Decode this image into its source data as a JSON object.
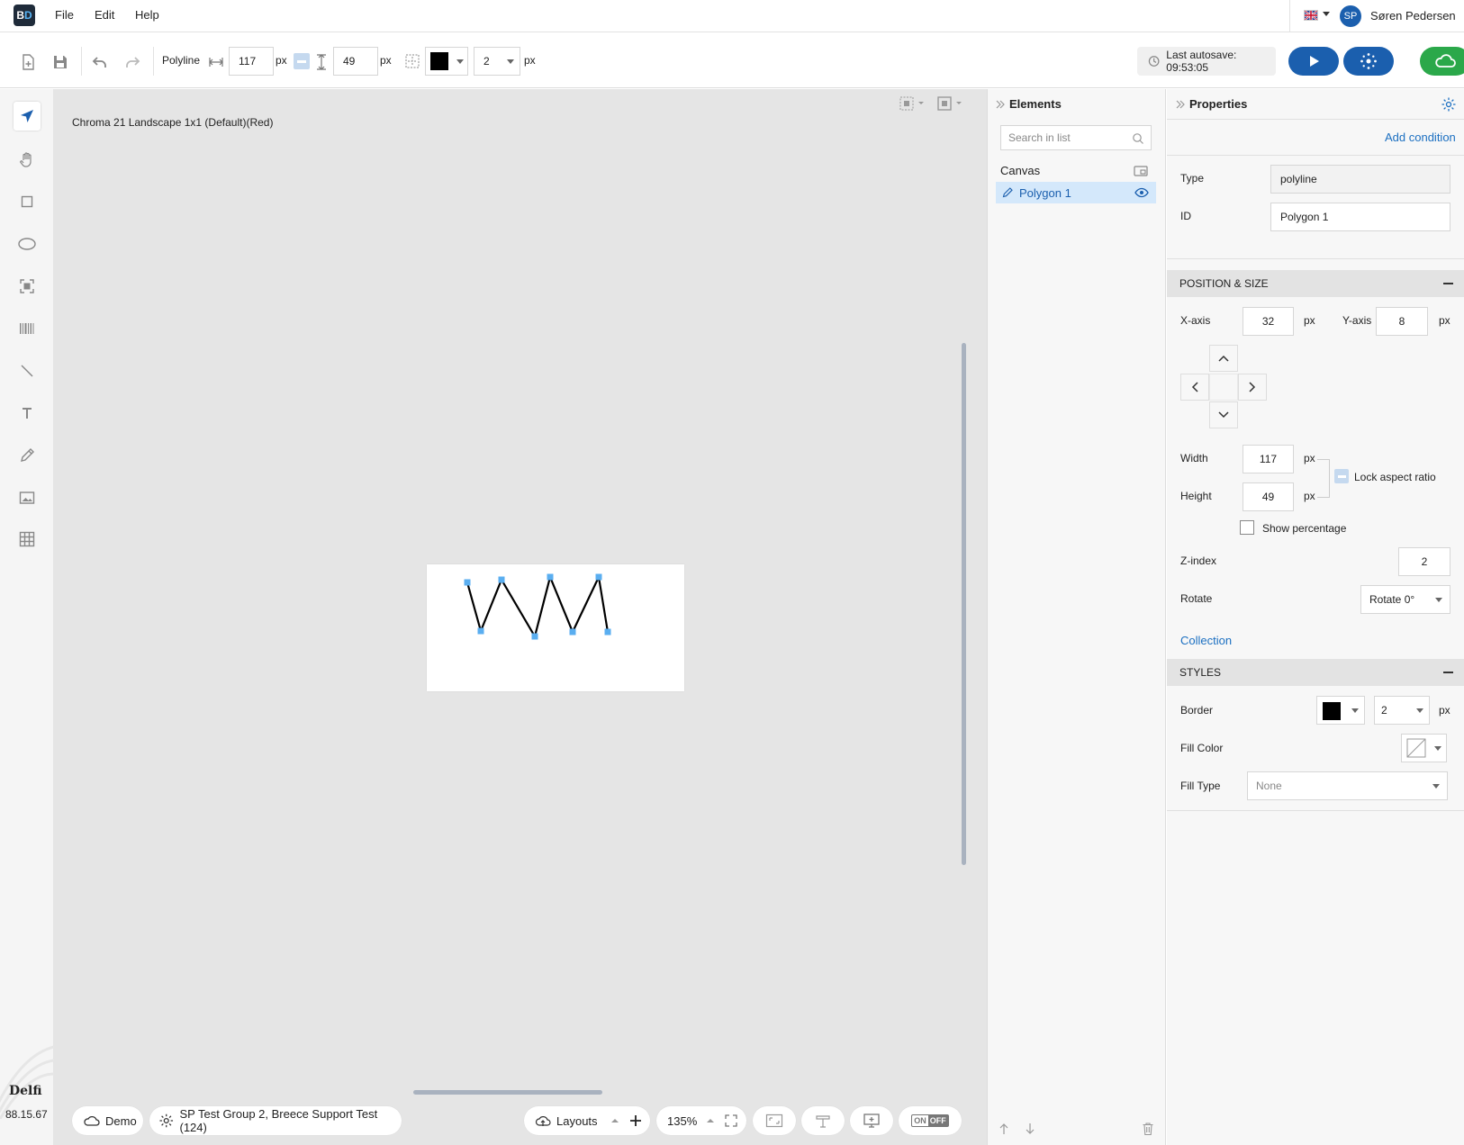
{
  "app": {
    "logo_text_b": "B",
    "logo_text_d": "D"
  },
  "menu": {
    "file": "File",
    "edit": "Edit",
    "help": "Help"
  },
  "user": {
    "initials": "SP",
    "name": "Søren Pedersen"
  },
  "toolbar": {
    "shape_type": "Polyline",
    "width_value": "117",
    "height_value": "49",
    "unit": "px",
    "border_color": "#000000",
    "border_width": "2",
    "autosave": "Last autosave: 09:53:05"
  },
  "canvas": {
    "label": "Chroma 21 Landscape 1x1 (Default)(Red)",
    "stroke_color": "#000000",
    "handle_color": "#5aaef0"
  },
  "footer": {
    "brand": "Delfi",
    "version": "88.15.67",
    "demo": "Demo",
    "group": "SP Test Group 2, Breece Support Test (124)",
    "layouts": "Layouts",
    "zoom": "135%",
    "onoff_on": "ON",
    "onoff_off": "OFF"
  },
  "elements": {
    "title": "Elements",
    "search_placeholder": "Search in list",
    "canvas_label": "Canvas",
    "items": [
      {
        "label": "Polygon 1"
      }
    ]
  },
  "properties": {
    "title": "Properties",
    "add_condition": "Add condition",
    "type_label": "Type",
    "type_value": "polyline",
    "id_label": "ID",
    "id_value": "Polygon 1",
    "position_section": "POSITION & SIZE",
    "x_label": "X-axis",
    "x_value": "32",
    "y_label": "Y-axis",
    "y_value": "8",
    "width_label": "Width",
    "width_value": "117",
    "height_label": "Height",
    "height_value": "49",
    "lock_aspect": "Lock aspect ratio",
    "show_percentage": "Show percentage",
    "zindex_label": "Z-index",
    "zindex_value": "2",
    "rotate_label": "Rotate",
    "rotate_value": "Rotate 0°",
    "collection": "Collection",
    "styles_section": "STYLES",
    "border_label": "Border",
    "border_width": "2",
    "fill_color_label": "Fill Color",
    "fill_type_label": "Fill Type",
    "fill_type_value": "None",
    "unit": "px"
  },
  "colors": {
    "accent": "#1b5fae",
    "cloud": "#2ba84a",
    "arrow": "#e8403f",
    "selected_row": "#d4e8fb"
  }
}
